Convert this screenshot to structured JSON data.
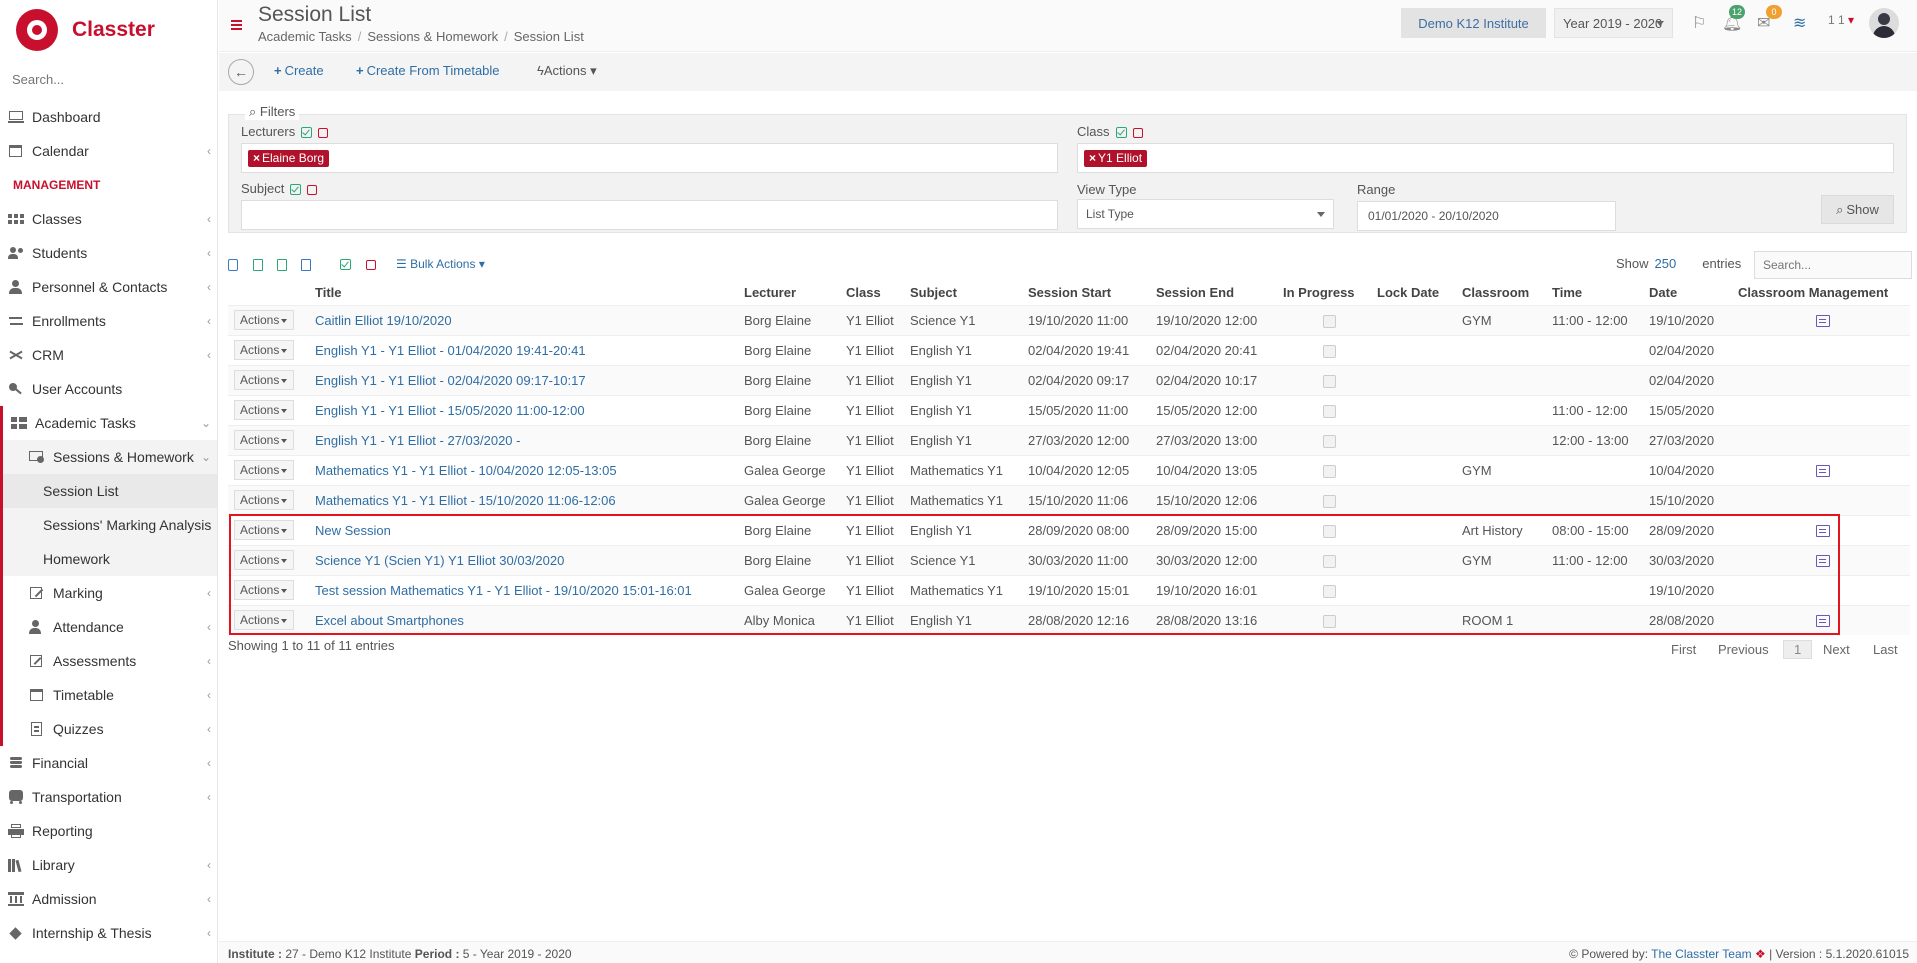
{
  "app": {
    "name": "Classter"
  },
  "sidebar": {
    "search_placeholder": "Search...",
    "items": [
      {
        "label": "Dashboard"
      },
      {
        "label": "Calendar"
      },
      {
        "label": "Classes"
      },
      {
        "label": "Students"
      },
      {
        "label": "Personnel & Contacts"
      },
      {
        "label": "Enrollments"
      },
      {
        "label": "CRM"
      },
      {
        "label": "User Accounts"
      },
      {
        "label": "Academic Tasks"
      },
      {
        "label": "Sessions & Homework"
      },
      {
        "label": "Session List"
      },
      {
        "label": "Sessions' Marking Analysis"
      },
      {
        "label": "Homework"
      },
      {
        "label": "Marking"
      },
      {
        "label": "Attendance"
      },
      {
        "label": "Assessments"
      },
      {
        "label": "Timetable"
      },
      {
        "label": "Quizzes"
      },
      {
        "label": "Financial"
      },
      {
        "label": "Transportation"
      },
      {
        "label": "Reporting"
      },
      {
        "label": "Library"
      },
      {
        "label": "Admission"
      },
      {
        "label": "Internship & Thesis"
      }
    ],
    "section_management": "MANAGEMENT"
  },
  "header": {
    "title": "Session List",
    "breadcrumb": [
      "Academic Tasks",
      "Sessions & Homework",
      "Session List"
    ],
    "institute": "Demo K12 Institute",
    "year": "Year 2019 - 2020",
    "notifications": "12",
    "messages": "0",
    "user_count": "1 1"
  },
  "toolbar": {
    "create": "Create",
    "create_from_timetable": "Create From Timetable",
    "actions": "Actions"
  },
  "filters": {
    "legend": "Filters",
    "lecturers_label": "Lecturers",
    "lecturers_tag": "Elaine Borg",
    "class_label": "Class",
    "class_tag": "Y1 Elliot",
    "subject_label": "Subject",
    "view_type_label": "View Type",
    "view_type_value": "List Type",
    "range_label": "Range",
    "range_value": "01/01/2020 - 20/10/2020",
    "show_button": "Show"
  },
  "table_tools": {
    "bulk_actions": "Bulk Actions",
    "show_label": "Show",
    "show_value": "250",
    "entries_label": "entries",
    "search_placeholder": "Search..."
  },
  "table": {
    "action_label": "Actions",
    "columns": [
      "Title",
      "Lecturer",
      "Class",
      "Subject",
      "Session Start",
      "Session End",
      "In Progress",
      "Lock Date",
      "Classroom",
      "Time",
      "Date",
      "Classroom Management"
    ],
    "rows": [
      [
        "Caitlin Elliot 19/10/2020",
        "Borg Elaine",
        "Y1 Elliot",
        "Science Y1",
        "19/10/2020 11:00",
        "19/10/2020 12:00",
        "GYM",
        "11:00 - 12:00",
        "19/10/2020"
      ],
      [
        "English Y1 - Y1 Elliot - 01/04/2020 19:41-20:41",
        "Borg Elaine",
        "Y1 Elliot",
        "English Y1",
        "02/04/2020 19:41",
        "02/04/2020 20:41",
        "",
        "",
        "02/04/2020"
      ],
      [
        "English Y1 - Y1 Elliot - 02/04/2020 09:17-10:17",
        "Borg Elaine",
        "Y1 Elliot",
        "English Y1",
        "02/04/2020 09:17",
        "02/04/2020 10:17",
        "",
        "",
        "02/04/2020"
      ],
      [
        "English Y1 - Y1 Elliot - 15/05/2020 11:00-12:00",
        "Borg Elaine",
        "Y1 Elliot",
        "English Y1",
        "15/05/2020 11:00",
        "15/05/2020 12:00",
        "",
        "11:00 - 12:00",
        "15/05/2020"
      ],
      [
        "English Y1 - Y1 Elliot - 27/03/2020 -",
        "Borg Elaine",
        "Y1 Elliot",
        "English Y1",
        "27/03/2020 12:00",
        "27/03/2020 13:00",
        "",
        "12:00 - 13:00",
        "27/03/2020"
      ],
      [
        "Mathematics Y1 - Y1 Elliot - 10/04/2020 12:05-13:05",
        "Galea George",
        "Y1 Elliot",
        "Mathematics Y1",
        "10/04/2020 12:05",
        "10/04/2020 13:05",
        "GYM",
        "",
        "10/04/2020"
      ],
      [
        "Mathematics Y1 - Y1 Elliot - 15/10/2020 11:06-12:06",
        "Galea George",
        "Y1 Elliot",
        "Mathematics Y1",
        "15/10/2020 11:06",
        "15/10/2020 12:06",
        "",
        "",
        "15/10/2020"
      ],
      [
        "New Session",
        "Borg Elaine",
        "Y1 Elliot",
        "English Y1",
        "28/09/2020 08:00",
        "28/09/2020 15:00",
        "Art History",
        "08:00 - 15:00",
        "28/09/2020"
      ],
      [
        "Science Y1 (Scien Y1) Y1 Elliot 30/03/2020",
        "Borg Elaine",
        "Y1 Elliot",
        "Science Y1",
        "30/03/2020 11:00",
        "30/03/2020 12:00",
        "GYM",
        "11:00 - 12:00",
        "30/03/2020"
      ],
      [
        "Test session Mathematics Y1 - Y1 Elliot - 19/10/2020 15:01-16:01",
        "Galea George",
        "Y1 Elliot",
        "Mathematics Y1",
        "19/10/2020 15:01",
        "19/10/2020 16:01",
        "",
        "",
        "19/10/2020"
      ],
      [
        "Excel about Smartphones",
        "Alby Monica",
        "Y1 Elliot",
        "English Y1",
        "28/08/2020 12:16",
        "28/08/2020 13:16",
        "ROOM 1",
        "",
        "28/08/2020"
      ]
    ],
    "mgmt_rows": [
      0,
      5,
      7,
      8,
      10
    ]
  },
  "pagination": {
    "info": "Showing 1 to 11 of 11 entries",
    "first": "First",
    "previous": "Previous",
    "current": "1",
    "next": "Next",
    "last": "Last"
  },
  "footer": {
    "institute_label": "Institute :",
    "institute_value": "27 - Demo K12 Institute",
    "period_label": "Period :",
    "period_value": "5 - Year 2019 - 2020",
    "powered_by": "Powered by:",
    "team": "The Classter Team",
    "version": "| Version : 5.1.2020.61015"
  },
  "colors": {
    "brand": "#c8102e",
    "link": "#2f6ea5",
    "highlight": "#e3141e"
  }
}
